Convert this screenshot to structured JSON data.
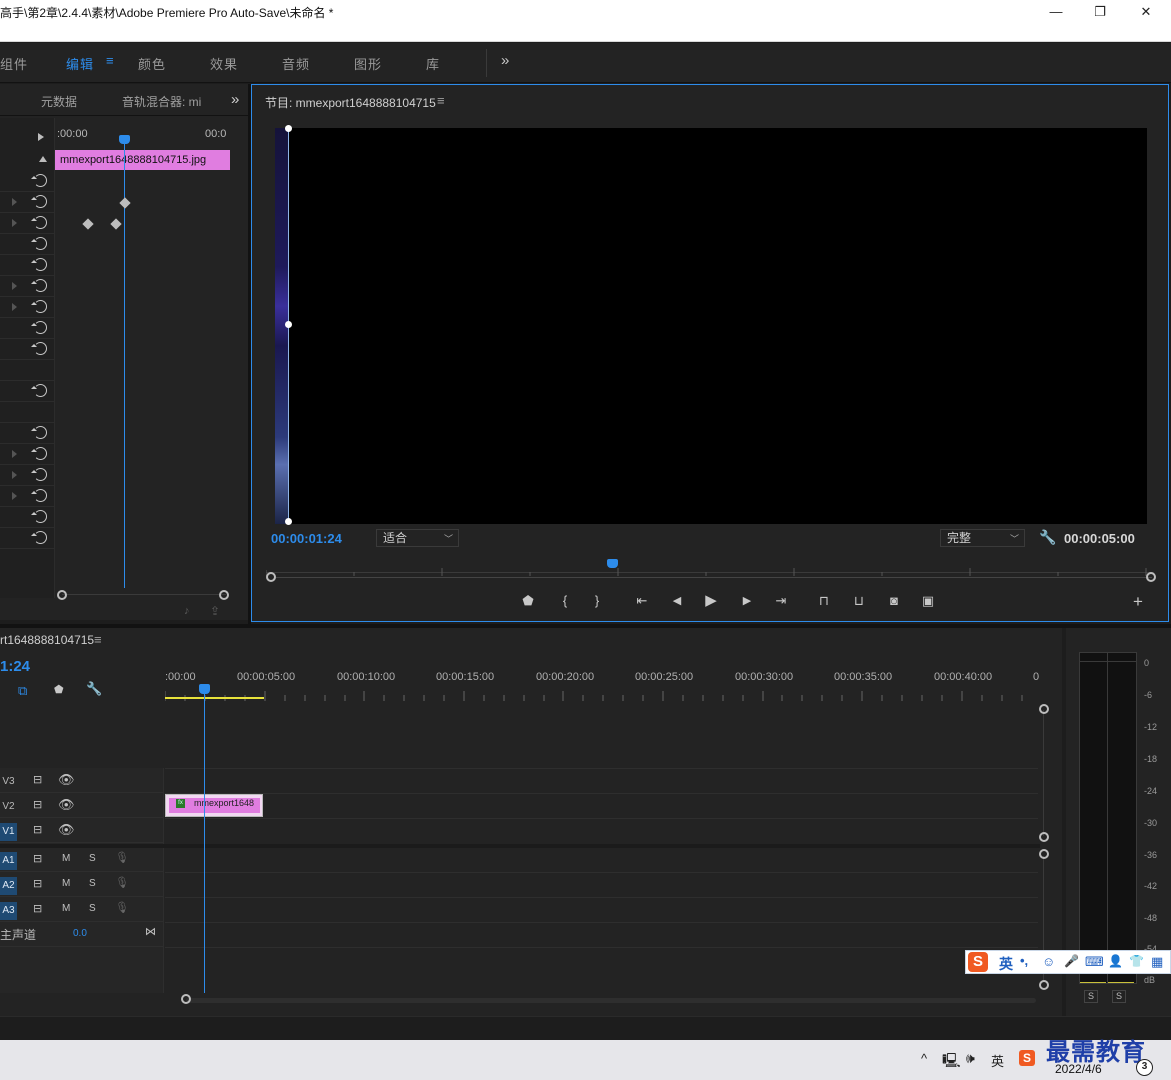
{
  "window": {
    "title": "高手\\第2章\\2.4.4\\素材\\Adobe Premiere Pro Auto-Save\\未命名 *",
    "minimize_glyph": "—",
    "restore_glyph": "❐",
    "close_glyph": "✕"
  },
  "workspaces": {
    "items": [
      {
        "label": "组件",
        "active": false
      },
      {
        "label": "编辑",
        "active": true
      },
      {
        "label": "颜色",
        "active": false
      },
      {
        "label": "效果",
        "active": false
      },
      {
        "label": "音频",
        "active": false
      },
      {
        "label": "图形",
        "active": false
      },
      {
        "label": "库",
        "active": false
      }
    ],
    "menu_glyph": "≡",
    "overflow_glyph": "»"
  },
  "effect_controls": {
    "tabs": [
      "元数据",
      "音轨混合器: mi"
    ],
    "overflow_glyph": "»",
    "ruler_start": ":00:00",
    "ruler_end": "00:0",
    "clip_name": "mmexport1648888104715.jpg"
  },
  "program_monitor": {
    "title": "节目: mmexport1648888104715",
    "menu_glyph": "≡",
    "current_timecode": "00:00:01:24",
    "fit_select": "适合",
    "quality_select": "完整",
    "duration_timecode": "00:00:05:00",
    "transport": {
      "add_marker": "⬟",
      "mark_in": "{",
      "mark_out": "}",
      "go_to_in": "⇤",
      "step_back": "◀",
      "play": "▶",
      "step_forward": "▶",
      "go_to_out": "⇥",
      "lift": "⊓",
      "extract": "⊔",
      "export_frame": "◙",
      "compare": "▣",
      "add_button": "+"
    }
  },
  "timeline": {
    "sequence_tab": "rt1648888104715",
    "menu_glyph": "≡",
    "current_timecode": "1:24",
    "ruler_labels": [
      ":00:00",
      "00:00:05:00",
      "00:00:10:00",
      "00:00:15:00",
      "00:00:20:00",
      "00:00:25:00",
      "00:00:30:00",
      "00:00:35:00",
      "00:00:40:00",
      "0"
    ],
    "video_tracks": [
      {
        "id": "V3",
        "targeted": false
      },
      {
        "id": "V2",
        "targeted": false
      },
      {
        "id": "V1",
        "targeted": true
      }
    ],
    "audio_tracks": [
      {
        "id": "A1",
        "m": "M",
        "s": "S"
      },
      {
        "id": "A2",
        "m": "M",
        "s": "S"
      },
      {
        "id": "A3",
        "m": "M",
        "s": "S"
      }
    ],
    "master": {
      "label": "主声道",
      "value": "0.0"
    },
    "clip": {
      "label": "mmexport1648",
      "fx": "fx"
    }
  },
  "audio_meter": {
    "scale": [
      "0",
      "-6",
      "-12",
      "-18",
      "-24",
      "-30",
      "-36",
      "-42",
      "-48",
      "-54",
      "dB"
    ],
    "solo_buttons": [
      "S",
      "S"
    ]
  },
  "ime_toolbar": {
    "logo": "S",
    "lang": "英",
    "punct": "•,",
    "items": [
      "☺",
      "🎤",
      "⌨",
      "👤",
      "👕",
      "▦"
    ]
  },
  "taskbar": {
    "caret": "^",
    "network_icon": "🖳",
    "volume_icon": "🕪",
    "ime_indicator": "英",
    "date": "2022/4/6",
    "notification_count": "3",
    "watermark": "最需教育"
  },
  "colors": {
    "accent": "#2d8ceb",
    "clip_pink": "#e07de0",
    "panel_bg": "#232323",
    "work_area": "#e8e23b"
  }
}
